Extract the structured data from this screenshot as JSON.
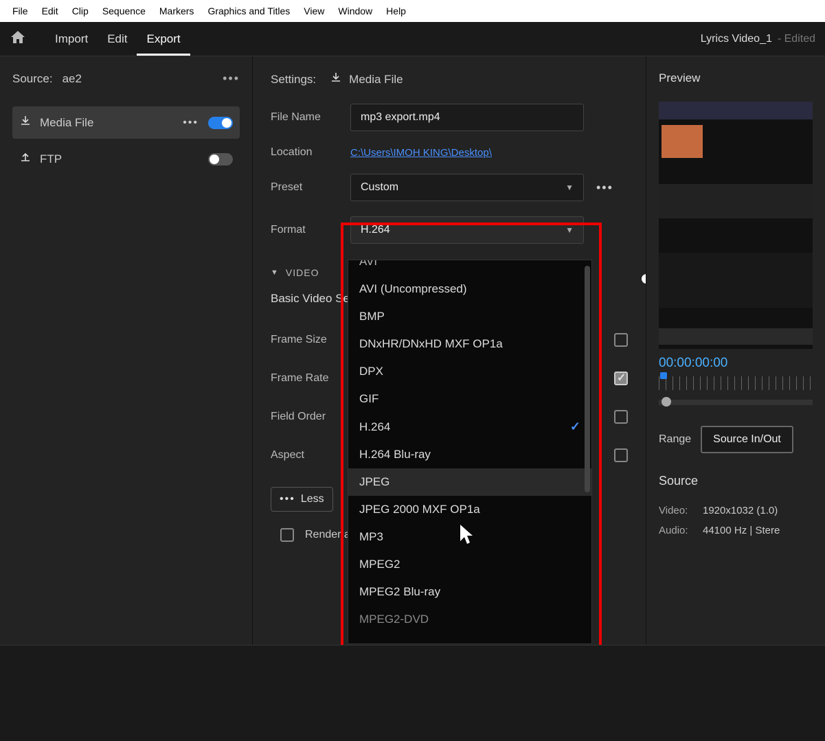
{
  "menubar": [
    "File",
    "Edit",
    "Clip",
    "Sequence",
    "Markers",
    "Graphics and Titles",
    "View",
    "Window",
    "Help"
  ],
  "header": {
    "tabs": [
      "Import",
      "Edit",
      "Export"
    ],
    "active_tab": "Export",
    "project_name": "Lyrics Video_1",
    "status": "- Edited"
  },
  "left": {
    "source_label": "Source:",
    "source_name": "ae2",
    "destinations": [
      {
        "id": "media-file",
        "label": "Media File",
        "on": true,
        "active": true
      },
      {
        "id": "ftp",
        "label": "FTP",
        "on": false,
        "active": false
      }
    ]
  },
  "settings": {
    "panel_label": "Settings:",
    "panel_target": "Media File",
    "file_name_label": "File Name",
    "file_name_value": "mp3 export.mp4",
    "location_label": "Location",
    "location_value": "C:\\Users\\IMOH KING\\Desktop\\",
    "preset_label": "Preset",
    "preset_value": "Custom",
    "format_label": "Format",
    "format_value": "H.264",
    "format_options": [
      {
        "label": "AVI",
        "selected": false,
        "hover": false,
        "cut": true
      },
      {
        "label": "AVI (Uncompressed)",
        "selected": false,
        "hover": false
      },
      {
        "label": "BMP",
        "selected": false,
        "hover": false
      },
      {
        "label": "DNxHR/DNxHD MXF OP1a",
        "selected": false,
        "hover": false
      },
      {
        "label": "DPX",
        "selected": false,
        "hover": false
      },
      {
        "label": "GIF",
        "selected": false,
        "hover": false
      },
      {
        "label": "H.264",
        "selected": true,
        "hover": false
      },
      {
        "label": "H.264 Blu-ray",
        "selected": false,
        "hover": false
      },
      {
        "label": "JPEG",
        "selected": false,
        "hover": true
      },
      {
        "label": "JPEG 2000 MXF OP1a",
        "selected": false,
        "hover": false
      },
      {
        "label": "MP3",
        "selected": false,
        "hover": false
      },
      {
        "label": "MPEG2",
        "selected": false,
        "hover": false
      },
      {
        "label": "MPEG2 Blu-ray",
        "selected": false,
        "hover": false
      },
      {
        "label": "MPEG2-DVD",
        "selected": false,
        "hover": false,
        "cut": true
      }
    ]
  },
  "video": {
    "section_label": "VIDEO",
    "basic_label": "Basic Video Settings",
    "rows": [
      {
        "label": "Frame Size",
        "checked": false
      },
      {
        "label": "Frame Rate",
        "checked": true
      },
      {
        "label": "Field Order",
        "checked": false
      },
      {
        "label": "Aspect",
        "checked": false
      }
    ],
    "less_label": "Less",
    "render_label": "Render at Max"
  },
  "preview": {
    "label": "Preview",
    "timecode": "00:00:00:00",
    "range_label": "Range",
    "range_value": "Source In/Out",
    "source_head": "Source",
    "video_label": "Video:",
    "video_value": "1920x1032 (1.0)",
    "audio_label": "Audio:",
    "audio_value": "44100 Hz | Stere"
  }
}
